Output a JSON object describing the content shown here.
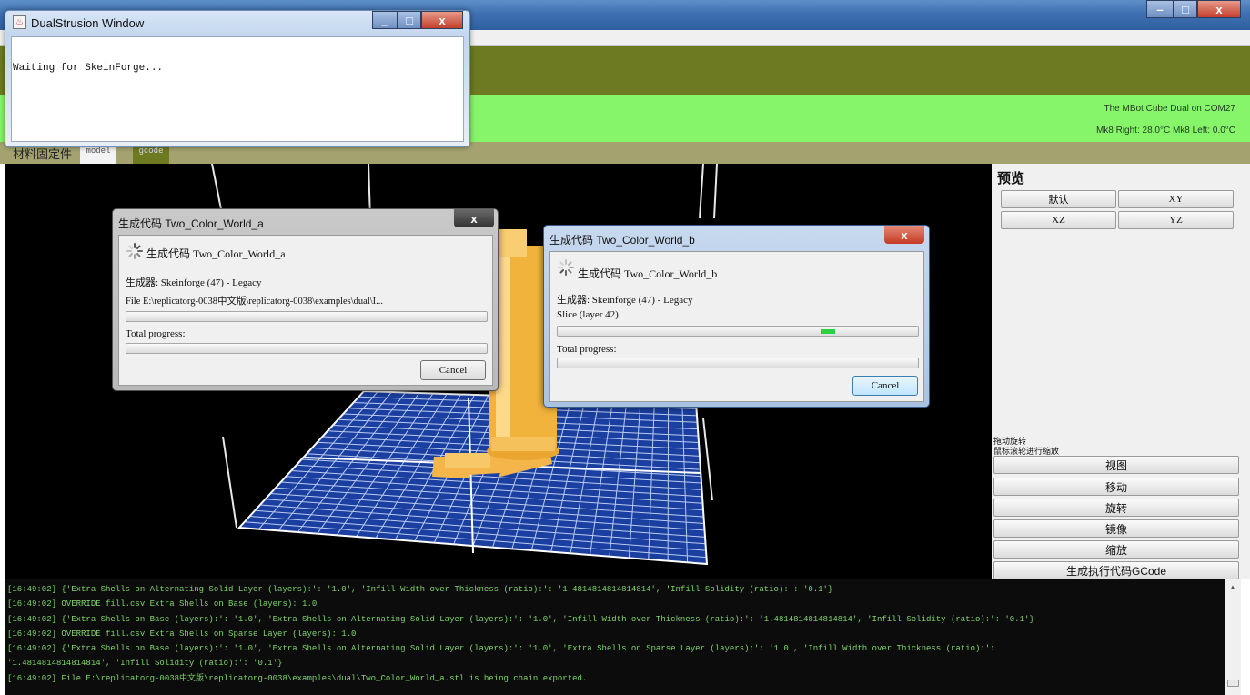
{
  "main_window": {
    "status_model": "The MBot Cube Dual on COM27",
    "status_temps": "Mk8 Right: 28.0°C  Mk8 Left: 0.0°C",
    "tabs": [
      "材料固定件",
      "model",
      "gcode"
    ]
  },
  "dual_window": {
    "title": "DualStrusion Window",
    "message": "Waiting for SkeinForge...",
    "buttons": [
      "_",
      "□",
      "x"
    ]
  },
  "dialog_a": {
    "title": "生成代码 Two_Color_World_a",
    "heading": "生成代码 Two_Color_World_a",
    "generator": "生成器: Skeinforge (47) - Legacy",
    "file": "File E:\\replicatorg-0038中文版\\replicatorg-0038\\examples\\dual\\I...",
    "progress": 0,
    "total_label": "Total progress:",
    "total_progress": 0,
    "cancel": "Cancel",
    "close": "x"
  },
  "dialog_b": {
    "title": "生成代码 Two_Color_World_b",
    "heading": "生成代码 Two_Color_World_b",
    "generator": "生成器: Skeinforge (47) - Legacy",
    "status": "Slice (layer 42)",
    "progress": 0.73,
    "total_label": "Total progress:",
    "total_progress": 0,
    "cancel": "Cancel",
    "close": "x"
  },
  "right_panel": {
    "title": "预览",
    "view_buttons": [
      "默认",
      "XY",
      "XZ",
      "YZ"
    ],
    "hint1": "拖动旋转",
    "hint2": "鼠标滚轮进行缩放",
    "action_buttons": [
      "视图",
      "移动",
      "旋转",
      "镜像",
      "缩放",
      "生成执行代码GCode"
    ]
  },
  "console": {
    "lines": [
      "[16:49:02] {'Extra Shells on Alternating Solid Layer (layers):': '1.0', 'Infill Width over Thickness (ratio):': '1.4814814814814814', 'Infill Solidity (ratio):': '0.1'}",
      "[16:49:02] OVERRIDE fill.csv Extra Shells on Base (layers): 1.0",
      "[16:49:02] {'Extra Shells on Base (layers):': '1.0', 'Extra Shells on Alternating Solid Layer (layers):': '1.0', 'Infill Width over Thickness (ratio):': '1.4814814814814814', 'Infill Solidity (ratio):': '0.1'}",
      "[16:49:02] OVERRIDE fill.csv Extra Shells on Sparse Layer (layers): 1.0",
      "[16:49:02] {'Extra Shells on Base (layers):': '1.0', 'Extra Shells on Alternating Solid Layer (layers):': '1.0', 'Extra Shells on Sparse Layer (layers):': '1.0', 'Infill Width over Thickness (ratio):':",
      "'1.4814814814814814', 'Infill Solidity (ratio):': '0.1'}",
      "[16:49:02] File E:\\replicatorg-0038中文版\\replicatorg-0038\\examples\\dual\\Two_Color_World_a.stl is being chain exported."
    ]
  },
  "colors": {
    "olive": "#6d7a22",
    "status_green": "#87f56a",
    "console_text": "#7fd66a",
    "platform_blue": "#1a3fa0",
    "model_orange": "#f2b33d"
  }
}
